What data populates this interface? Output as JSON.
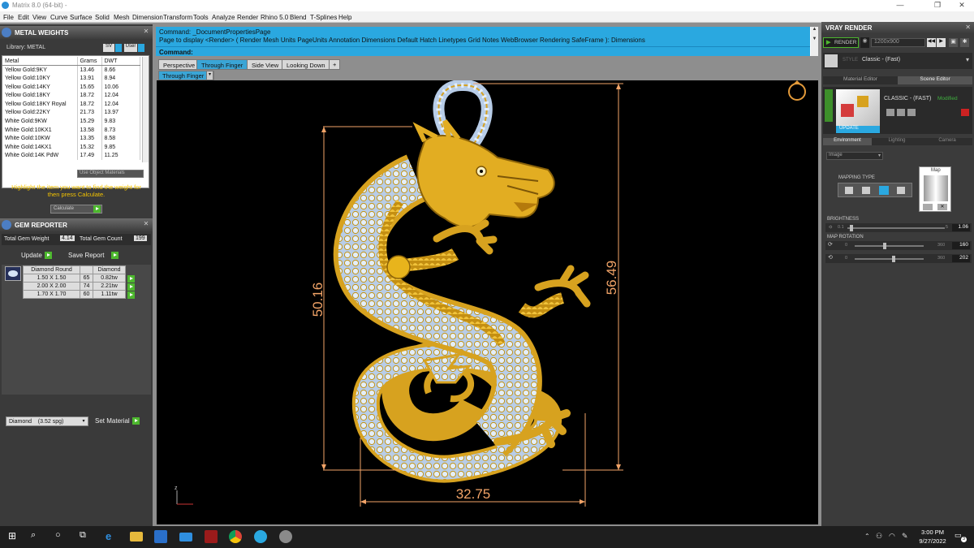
{
  "titlebar": {
    "title": "Matrix 8.0 (64-bit) -"
  },
  "menu": [
    "File",
    "Edit",
    "View",
    "Curve",
    "Surface",
    "Solid",
    "Mesh",
    "Dimension",
    "Transform",
    "Tools",
    "Analyze",
    "Render",
    "Rhino 5.0",
    "Blend",
    "T-Splines",
    "Help"
  ],
  "metal_weights": {
    "title": "METAL WEIGHTS",
    "library_label": "Library: METAL",
    "sv_label": "SV",
    "user_label": "User",
    "columns": [
      "Metal",
      "Grams",
      "DWT"
    ],
    "rows": [
      [
        "Yellow Gold:9KY",
        "13.46",
        "8.66"
      ],
      [
        "Yellow Gold:10KY",
        "13.91",
        "8.94"
      ],
      [
        "Yellow Gold:14KY",
        "15.65",
        "10.06"
      ],
      [
        "Yellow Gold:18KY",
        "18.72",
        "12.04"
      ],
      [
        "Yellow Gold:18KY Royal",
        "18.72",
        "12.04"
      ],
      [
        "Yellow Gold:22KY",
        "21.73",
        "13.97"
      ],
      [
        "White Gold:9KW",
        "15.29",
        "9.83"
      ],
      [
        "White Gold:10KX1",
        "13.58",
        "8.73"
      ],
      [
        "White Gold:10KW",
        "13.35",
        "8.58"
      ],
      [
        "White Gold:14KX1",
        "15.32",
        "9.85"
      ],
      [
        "White Gold:14K PdW",
        "17.49",
        "11.25"
      ]
    ],
    "use_object_materials": "Use Object Materials",
    "hint": "Highlight the item you want to find the weight for then press Calculate.",
    "calculate": "Calculate"
  },
  "gem_reporter": {
    "title": "GEM REPORTER",
    "total_gem_weight_label": "Total Gem Weight",
    "total_gem_weight": "4.14",
    "total_gem_count_label": "Total Gem Count",
    "total_gem_count": "199",
    "update": "Update",
    "save_report": "Save Report",
    "columns": [
      "Diamond Round",
      "",
      "Diamond"
    ],
    "rows": [
      [
        "1.50 X 1.50",
        "65",
        "0.82tw"
      ],
      [
        "2.00 X 2.00",
        "74",
        "2.21tw"
      ],
      [
        "1.70 X 1.70",
        "60",
        "1.11tw"
      ]
    ],
    "material_select": "Diamond    (3.52 spg)",
    "set_material": "Set Material"
  },
  "command": {
    "line1": "Command: _DocumentPropertiesPage",
    "line2": "Page to display <Render> ( Render  Mesh  Units  PageUnits  Annotation  Dimensions  Default  Hatch  Linetypes  Grid  Notes  WebBrowser  Rendering  SafeFrame ): Dimensions",
    "prompt": "Command:"
  },
  "viewport_tabs": [
    "Perspective",
    "Through Finger",
    "Side View",
    "Looking Down"
  ],
  "viewport": {
    "subtab": "Through Finger",
    "dim_height_left": "50.16",
    "dim_height_right": "56.49",
    "dim_width": "32.75",
    "axis_label": "z"
  },
  "vray": {
    "title": "VRAY RENDER",
    "render": "RENDER",
    "resolution": "1200x900",
    "preset_label": "STYLE",
    "preset": "Classic - (Fast)",
    "tabs": [
      "Material Editor",
      "Scene Editor"
    ],
    "scene_name": "CLASSIC - (FAST)",
    "modified": "Modified",
    "update": "UPDATE",
    "env_tabs": [
      "Environment",
      "Lighting",
      "Camera"
    ],
    "env_select": "Image",
    "mapping_type": "MAPPING TYPE",
    "map_label": "Map",
    "brightness_label": "BRIGHTNESS",
    "brightness_min": "0.1",
    "brightness_max": "5",
    "brightness_value": "1.06",
    "brightness_level": 0.04,
    "map_rotation_label": "MAP ROTATION",
    "rot_min": "0",
    "rot_max": "360",
    "rot1_value": "160",
    "rot1_level": 0.44,
    "rot2_value": "202",
    "rot2_level": 0.56
  },
  "taskbar": {
    "time": "3:00 PM",
    "date": "9/27/2022",
    "notif": "3"
  },
  "colors": {
    "accent": "#2aa8e0",
    "gold": "#e8b41c",
    "dim": "#f2a468",
    "ice": "#c4d8ef",
    "green": "#4db82e"
  }
}
